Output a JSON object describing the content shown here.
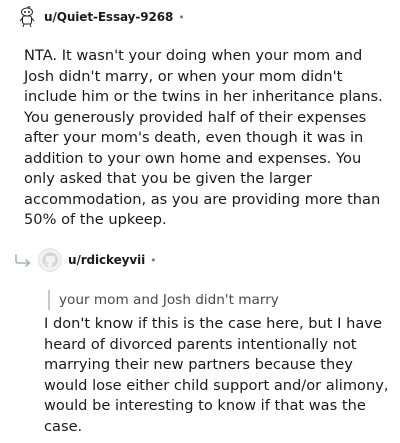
{
  "comments": [
    {
      "username": "u/Quiet-Essay-9268",
      "separator": "•",
      "avatar_icon": "snoo-avatar-icon",
      "body": "NTA. It wasn't your doing when your mom and Josh didn't marry, or when your mom didn't include him or the twins in her inheritance plans. You generously provided half of their expenses after your mom's death, even though it was in addition to your own home and expenses. You only asked that you be given the larger accommodation, as you are providing more than 50% of the upkeep."
    },
    {
      "username": "u/rdickeyvii",
      "separator": "•",
      "avatar_icon": "github-octocat-avatar-icon",
      "reply_icon": "reply-arrow-icon",
      "quote": "your mom and Josh didn't marry",
      "body": "I don't know if this is the case here, but I have heard of divorced parents intentionally not marrying their new partners because they would lose either child support and/or alimony, would be interesting to know if that was the case."
    }
  ]
}
